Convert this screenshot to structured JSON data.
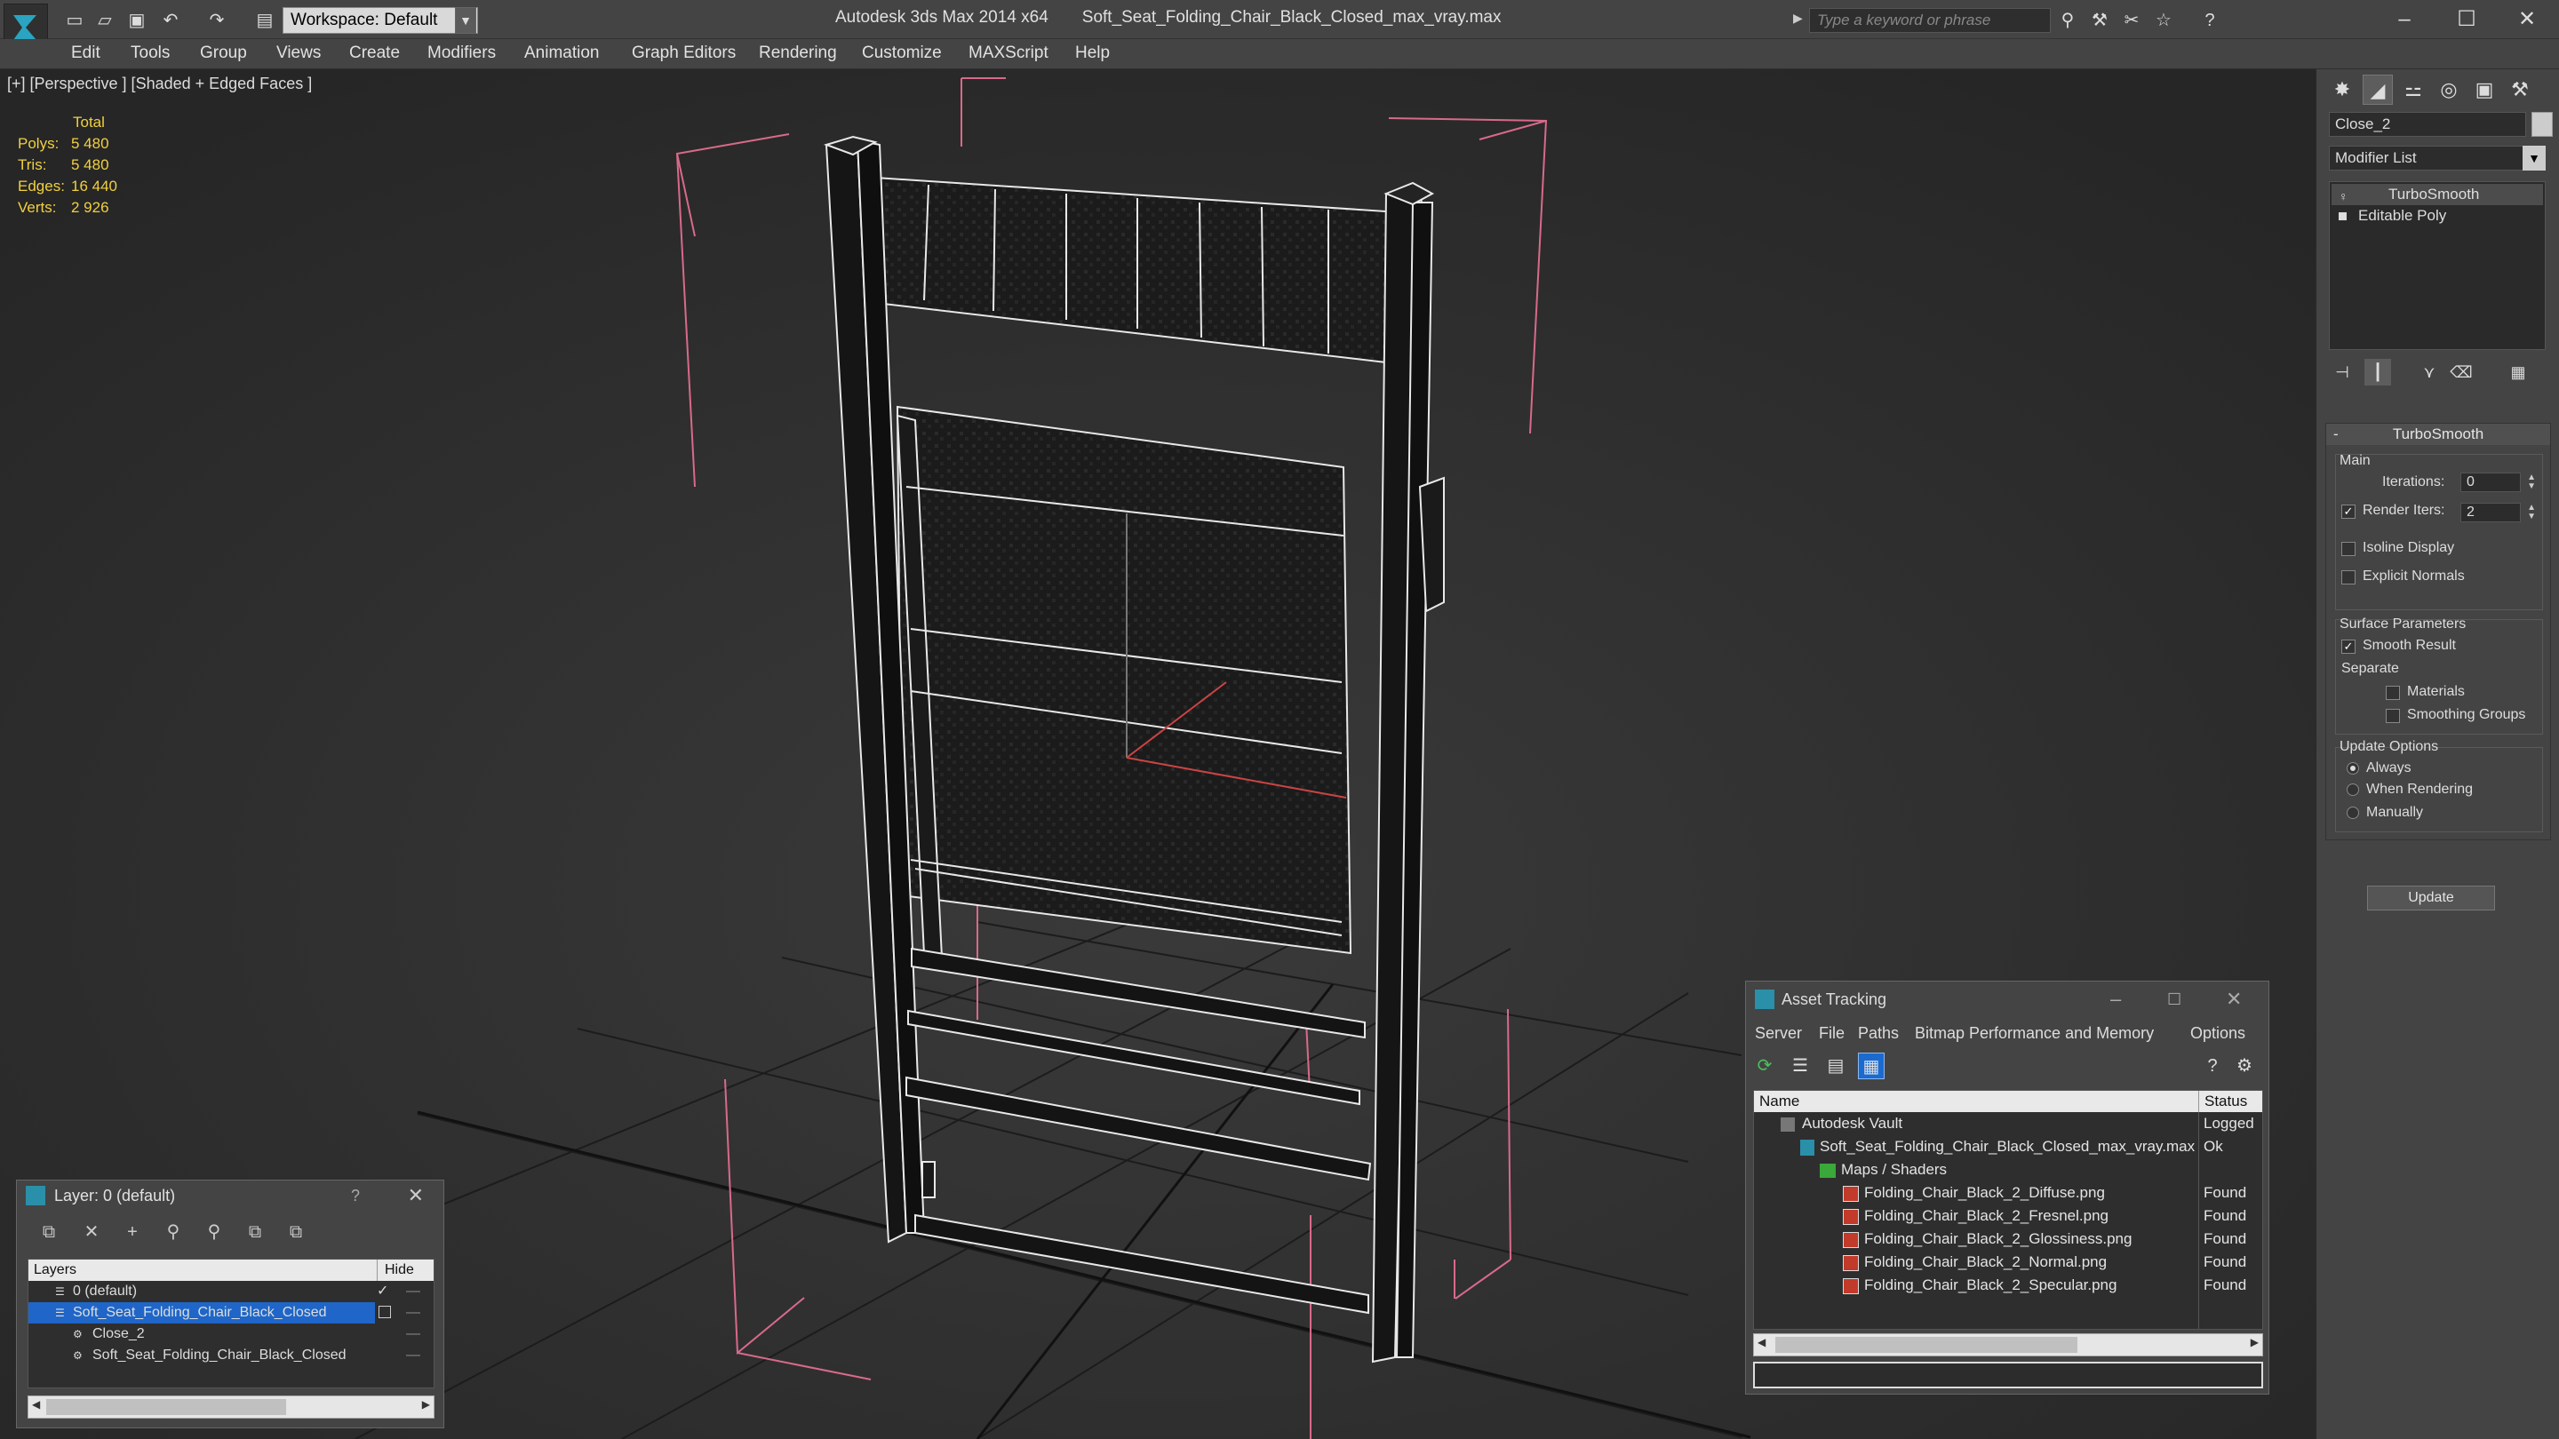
{
  "app": {
    "title": "Autodesk 3ds Max  2014 x64",
    "filename": "Soft_Seat_Folding_Chair_Black_Closed_max_vray.max",
    "workspace": "Workspace: Default",
    "search_placeholder": "Type a keyword or phrase"
  },
  "menu": [
    "Edit",
    "Tools",
    "Group",
    "Views",
    "Create",
    "Modifiers",
    "Animation",
    "Graph Editors",
    "Rendering",
    "Customize",
    "MAXScript",
    "Help"
  ],
  "viewport": {
    "label": "[+] [Perspective ] [Shaded + Edged Faces ]",
    "stats": {
      "header": "Total",
      "rows": [
        {
          "k": "Polys:",
          "v": "5 480"
        },
        {
          "k": "Tris:",
          "v": "5 480"
        },
        {
          "k": "Edges:",
          "v": "16 440"
        },
        {
          "k": "Verts:",
          "v": "2 926"
        }
      ]
    }
  },
  "command_panel": {
    "object_name": "Close_2",
    "modifier_list": "Modifier List",
    "stack": [
      "TurboSmooth",
      "Editable Poly"
    ],
    "turbosmooth": {
      "title": "TurboSmooth",
      "main_label": "Main",
      "iterations_label": "Iterations:",
      "iterations": "0",
      "render_iters_label": "Render Iters:",
      "render_iters": "2",
      "isoline": "Isoline Display",
      "explicit_normals": "Explicit Normals",
      "surface_params": "Surface Parameters",
      "smooth_result": "Smooth Result",
      "separate": "Separate",
      "materials": "Materials",
      "smoothing_groups": "Smoothing Groups",
      "update_options": "Update Options",
      "always": "Always",
      "when_rendering": "When Rendering",
      "manually": "Manually",
      "update_btn": "Update"
    }
  },
  "layer_window": {
    "title": "Layer: 0 (default)",
    "help": "?",
    "col_layers": "Layers",
    "col_hide": "Hide",
    "rows": [
      "0 (default)",
      "Soft_Seat_Folding_Chair_Black_Closed",
      "Close_2",
      "Soft_Seat_Folding_Chair_Black_Closed"
    ]
  },
  "asset_tracking": {
    "title": "Asset Tracking",
    "menu": [
      "Server",
      "File",
      "Paths",
      "Bitmap Performance and Memory",
      "Options"
    ],
    "col_name": "Name",
    "col_status": "Status",
    "rows": [
      {
        "name": "Autodesk Vault",
        "status": "Logged"
      },
      {
        "name": "Soft_Seat_Folding_Chair_Black_Closed_max_vray.max",
        "status": "Ok"
      },
      {
        "name": "Maps / Shaders",
        "status": ""
      },
      {
        "name": "Folding_Chair_Black_2_Diffuse.png",
        "status": "Found"
      },
      {
        "name": "Folding_Chair_Black_2_Fresnel.png",
        "status": "Found"
      },
      {
        "name": "Folding_Chair_Black_2_Glossiness.png",
        "status": "Found"
      },
      {
        "name": "Folding_Chair_Black_2_Normal.png",
        "status": "Found"
      },
      {
        "name": "Folding_Chair_Black_2_Specular.png",
        "status": "Found"
      }
    ]
  }
}
